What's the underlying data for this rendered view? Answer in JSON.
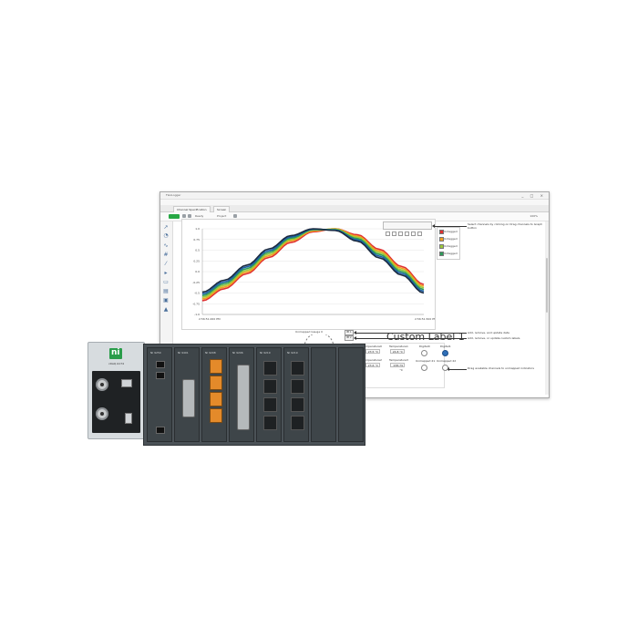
{
  "window": {
    "title": "FlexLogger",
    "controls": "_ □ ×",
    "menu": [
      "File",
      "Edit",
      "Project",
      "View",
      "Help"
    ],
    "tabs": [
      "Channel Specification",
      "Screen"
    ],
    "run_label": "RUN",
    "toolbar_items": [
      "Ready",
      "Project"
    ],
    "zoom": "100%"
  },
  "graph": {
    "y_ticks": [
      "1.0",
      "0.75",
      "0.5",
      "0.25",
      "0.0",
      "-0.25",
      "-0.5",
      "-0.75",
      "-1.0"
    ],
    "x_start": "2:56:51.000 PM",
    "x_end": "2:56:51.500 PM",
    "legend": [
      "Untagged",
      "Untagged",
      "Untagged",
      "Untagged"
    ],
    "series_colors": [
      "#e03030",
      "#f0a020",
      "#9bc93a",
      "#2e9a5a",
      "#1d5fa6",
      "#1a2a40"
    ]
  },
  "chart_data": {
    "type": "line",
    "title": "",
    "xlabel": "",
    "ylabel": "",
    "ylim": [
      -1,
      1
    ],
    "x": [
      0,
      0.1,
      0.2,
      0.3,
      0.4,
      0.5,
      0.6,
      0.7,
      0.8,
      0.9,
      1.0
    ],
    "series": [
      {
        "values": [
          -0.68,
          -0.4,
          -0.05,
          0.33,
          0.68,
          0.93,
          1.0,
          0.86,
          0.52,
          0.12,
          -0.3
        ]
      },
      {
        "values": [
          -0.64,
          -0.36,
          -0.01,
          0.37,
          0.72,
          0.95,
          1.0,
          0.83,
          0.48,
          0.08,
          -0.34
        ]
      },
      {
        "values": [
          -0.6,
          -0.32,
          0.03,
          0.41,
          0.75,
          0.97,
          0.99,
          0.8,
          0.44,
          0.04,
          -0.38
        ]
      },
      {
        "values": [
          -0.56,
          -0.28,
          0.07,
          0.45,
          0.78,
          0.98,
          0.98,
          0.77,
          0.4,
          0.0,
          -0.42
        ]
      },
      {
        "values": [
          -0.52,
          -0.24,
          0.11,
          0.49,
          0.81,
          0.99,
          0.97,
          0.74,
          0.36,
          -0.04,
          -0.46
        ]
      },
      {
        "values": [
          -0.48,
          -0.2,
          0.15,
          0.53,
          0.84,
          1.0,
          0.96,
          0.71,
          0.32,
          -0.08,
          -0.5
        ]
      }
    ]
  },
  "annotations": [
    "Select channels by clicking on Drag channels to Graph button",
    "Add, remove, and update data",
    "Add, remove, or update custom labels",
    "Drag available channels to unmapped indicators"
  ],
  "dashboard": {
    "custom_label": "Custom Label 1",
    "gauge_title": "Unmapped Gauge 0",
    "buttons": [
      "Bt 1",
      "Bt 2"
    ],
    "numerics": [
      {
        "label": "Temperature0",
        "value": "23.5 °C"
      },
      {
        "label": "Temperature1",
        "value": "24.8 °C"
      },
      {
        "label": "Temperature2",
        "value": "23.6 °C"
      },
      {
        "label": "Temperature3",
        "value": "238.79 °C"
      }
    ],
    "indicators": [
      {
        "label": "Digital0",
        "on": false
      },
      {
        "label": "Digital1",
        "on": true
      },
      {
        "label": "Unmapped 21",
        "on": false
      },
      {
        "label": "Unmapped 22",
        "on": false
      }
    ]
  },
  "hardware": {
    "controller_model": "cDAQ-9174",
    "modules": [
      "NI 9250",
      "NI 9401",
      "NI 9208",
      "NI 9206",
      "NI 9219",
      "NI 9219",
      "",
      ""
    ]
  }
}
